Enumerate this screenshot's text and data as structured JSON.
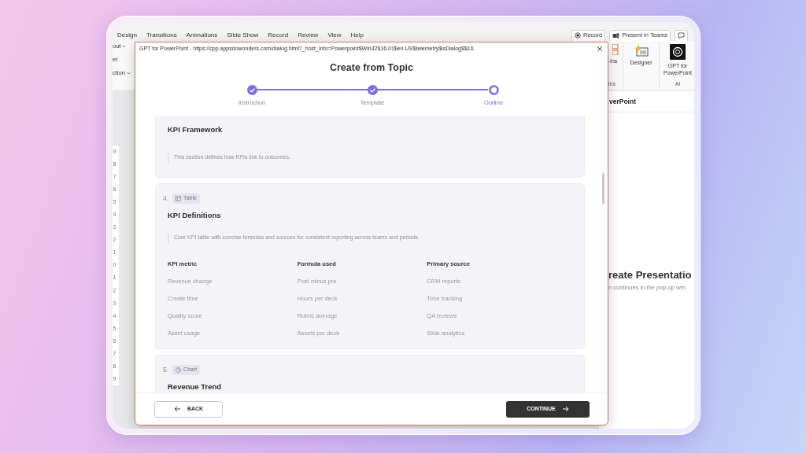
{
  "ribbon": {
    "tabs": [
      "Design",
      "Transitions",
      "Animations",
      "Slide Show",
      "Record",
      "Review",
      "View",
      "Help"
    ],
    "actions": [
      {
        "kind": "record",
        "label": "Record"
      },
      {
        "kind": "teams",
        "label": "Present in Teams"
      },
      {
        "kind": "comment"
      }
    ],
    "left_commands": [
      {
        "label": "out",
        "has_menu": true
      },
      {
        "label": "et",
        "has_menu": false
      },
      {
        "label": "ction",
        "has_menu": true
      }
    ],
    "right_commands": [
      {
        "kind": "addins",
        "label": "-ins"
      },
      {
        "kind": "designer",
        "label": "Designer"
      },
      {
        "kind": "gpt",
        "label": "GPT for PowerPoint"
      }
    ],
    "group_labels": [
      "ins",
      "AI"
    ]
  },
  "ruler": [
    "9",
    "8",
    "7",
    "6",
    "5",
    "4",
    "3",
    "2",
    "1",
    "0",
    "1",
    "2",
    "3",
    "4",
    "5",
    "6",
    "7",
    "8",
    "9"
  ],
  "task_pane": {
    "title": "verPoint",
    "heading": "reate Presentatio",
    "note": "n continues in the pop-up win"
  },
  "dialog": {
    "title": "GPT for PowerPoint - https://cpp.appsdowonders.com/dialog.html?_host_Info=Powerpoint$Win32$16.01$en-US$telemetry$isDialog$$16",
    "heading": "Create from Topic",
    "steps": [
      {
        "label": "Instruction",
        "completed": true,
        "selected": false
      },
      {
        "label": "Template",
        "completed": true,
        "selected": false
      },
      {
        "label": "Outline",
        "completed": false,
        "selected": true
      }
    ],
    "sections": [
      {
        "title": "KPI Framework",
        "description": "This section defines how KPIs link to outcomes."
      },
      {
        "number": "4.",
        "tag": {
          "kind": "table",
          "label": "Table"
        },
        "title": "KPI Definitions",
        "description": "Core KPI table with concise formulas and sources for consistent reporting across teams and periods.",
        "table": {
          "columns": [
            "KPI metric",
            "Formula used",
            "Primary source"
          ],
          "rows": [
            [
              "Revenue change",
              "Post minus pre",
              "CRM reports"
            ],
            [
              "Create time",
              "Hours per deck",
              "Time tracking"
            ],
            [
              "Quality score",
              "Rubric average",
              "QA reviews"
            ],
            [
              "Asset usage",
              "Assets per deck",
              "Slide analytics"
            ]
          ]
        }
      },
      {
        "number": "5.",
        "tag": {
          "kind": "chart",
          "label": "Chart"
        },
        "title": "Revenue Trend"
      }
    ],
    "back_button": "BACK",
    "continue_button": "CONTINUE"
  }
}
